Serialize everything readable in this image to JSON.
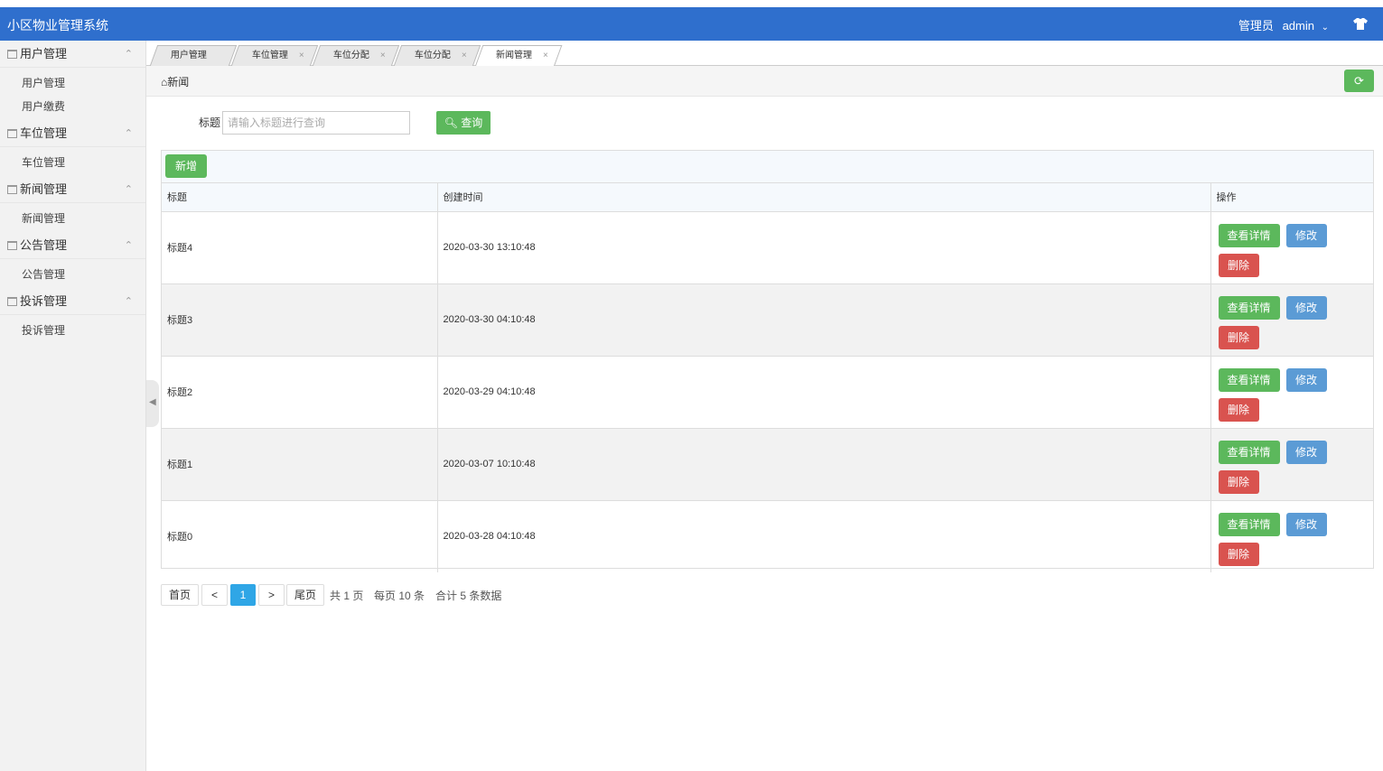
{
  "app": {
    "title": "小区物业管理系统",
    "user_label": "管理员",
    "user_name": "admin"
  },
  "sidebar": {
    "groups": [
      {
        "label": "用户管理",
        "items": [
          "用户管理",
          "用户缴费"
        ]
      },
      {
        "label": "车位管理",
        "items": [
          "车位管理"
        ]
      },
      {
        "label": "新闻管理",
        "items": [
          "新闻管理"
        ]
      },
      {
        "label": "公告管理",
        "items": [
          "公告管理"
        ]
      },
      {
        "label": "投诉管理",
        "items": [
          "投诉管理"
        ]
      }
    ]
  },
  "tabs": [
    {
      "label": "用户管理",
      "closable": false
    },
    {
      "label": "车位管理",
      "closable": true
    },
    {
      "label": "车位分配",
      "closable": true
    },
    {
      "label": "车位分配",
      "closable": true
    },
    {
      "label": "新闻管理",
      "closable": true,
      "active": true
    }
  ],
  "breadcrumb": "新闻",
  "search": {
    "label": "标题",
    "placeholder": "请输入标题进行查询",
    "button": "查询"
  },
  "toolbar": {
    "add_label": "新增"
  },
  "table": {
    "columns": [
      "标题",
      "创建时间",
      "操作"
    ],
    "rows": [
      {
        "title": "标题4",
        "created": "2020-03-30 13:10:48"
      },
      {
        "title": "标题3",
        "created": "2020-03-30 04:10:48"
      },
      {
        "title": "标题2",
        "created": "2020-03-29 04:10:48"
      },
      {
        "title": "标题1",
        "created": "2020-03-07 10:10:48"
      },
      {
        "title": "标题0",
        "created": "2020-03-28 04:10:48"
      }
    ],
    "actions": {
      "detail": "查看详情",
      "edit": "修改",
      "delete": "删除"
    }
  },
  "pager": {
    "first": "首页",
    "prev": "<",
    "current": "1",
    "next": ">",
    "last": "尾页",
    "total_pages": "共 1 页",
    "page_size": "每页 10 条",
    "total": "合计 5 条数据"
  },
  "colors": {
    "header": "#2f6fcd",
    "primary_green": "#5cb85c",
    "edit_blue": "#5b9bd5",
    "danger_red": "#d9534f",
    "pager_active": "#2fa6e6"
  }
}
